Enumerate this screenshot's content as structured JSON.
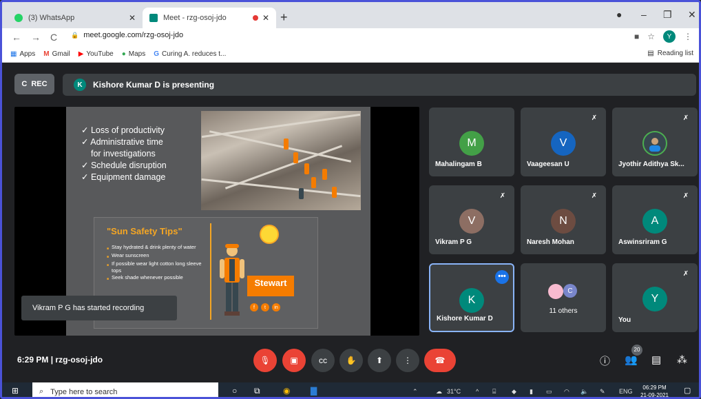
{
  "browser": {
    "tabs": [
      {
        "title": "(3) WhatsApp",
        "active": false
      },
      {
        "title": "Meet - rzg-osoj-jdo",
        "active": true
      }
    ],
    "url": "meet.google.com/rzg-osoj-jdo",
    "profile_initial": "Y",
    "bookmarks": [
      {
        "label": "Apps",
        "icon": "apps-grid-icon"
      },
      {
        "label": "Gmail",
        "icon": "gmail-icon"
      },
      {
        "label": "YouTube",
        "icon": "youtube-icon"
      },
      {
        "label": "Maps",
        "icon": "maps-pin-icon"
      },
      {
        "label": "Curing A. reduces t...",
        "icon": "google-icon"
      }
    ],
    "reading_list": "Reading list"
  },
  "meet": {
    "rec_label": "REC",
    "presenter_initial": "K",
    "presenting_text": "Kishore Kumar D is presenting",
    "slide": {
      "bullets": [
        "✓ Loss of productivity",
        "✓ Administrative time",
        "for investigations",
        "✓ Schedule disruption",
        "✓ Equipment damage"
      ],
      "sun_title": "\"Sun Safety Tips\"",
      "sun_tips": [
        "Stay hydrated & drink plenty of water",
        "Wear sunscreen",
        "If possible wear light cotton long sleeve tops",
        "Seek shade whenever possible"
      ],
      "brand": "Stewart"
    },
    "toast": "Vikram P G has started recording",
    "participants": [
      {
        "initial": "M",
        "name": "Mahalingam B",
        "color": "#43a047",
        "muted": false
      },
      {
        "initial": "V",
        "name": "Vaageesan U",
        "color": "#1565c0",
        "muted": true
      },
      {
        "initial": "",
        "name": "Jyothir Adithya Sk...",
        "color": "#37474f",
        "muted": true
      },
      {
        "initial": "V",
        "name": "Vikram P G",
        "color": "#8d6e63",
        "muted": true
      },
      {
        "initial": "N",
        "name": "Naresh Mohan",
        "color": "#6d4c41",
        "muted": true
      },
      {
        "initial": "A",
        "name": "Aswinsriram G",
        "color": "#00897b",
        "muted": true
      },
      {
        "initial": "K",
        "name": "Kishore Kumar D",
        "color": "#00897b",
        "muted": false
      },
      {
        "initial": "C",
        "name": "11 others",
        "color": "#7986cb",
        "muted": false
      },
      {
        "initial": "Y",
        "name": "You",
        "color": "#00897b",
        "muted": true
      }
    ],
    "time": "6:29 PM",
    "meeting_code": "rzg-osoj-jdo",
    "participant_count": "20"
  },
  "taskbar": {
    "search_placeholder": "Type here to search",
    "temperature": "31°C",
    "language": "ENG",
    "clock_time": "06:29 PM",
    "clock_date": "21-09-2021"
  }
}
